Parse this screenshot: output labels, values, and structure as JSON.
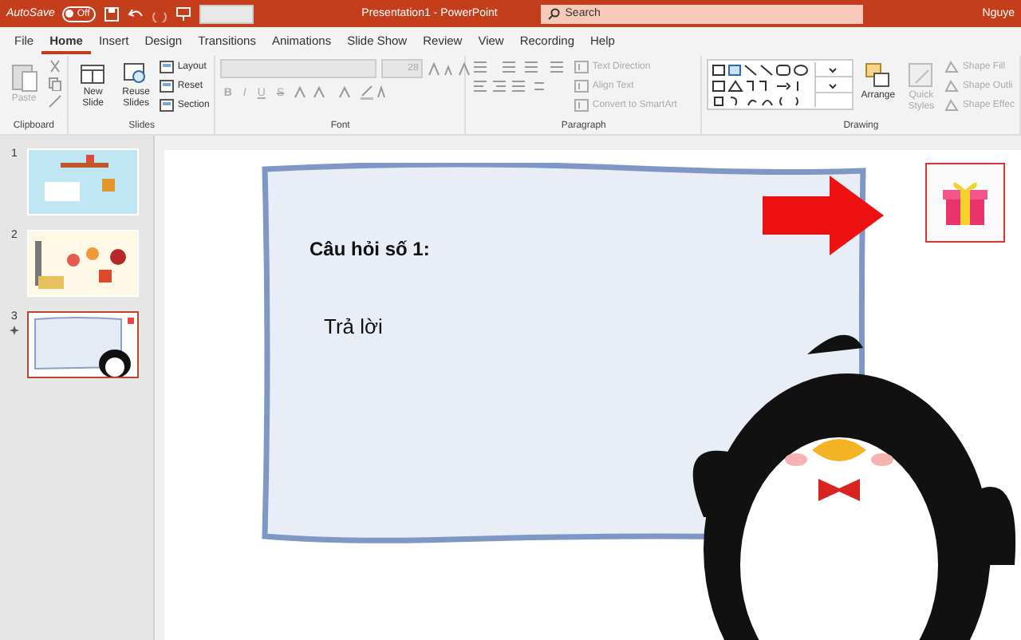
{
  "title_bar": {
    "autosave_label": "AutoSave",
    "autosave_on": false,
    "autosave_state": "Off",
    "title": "Presentation1 - PowerPoint",
    "search_placeholder": "Search",
    "user": "Nguye"
  },
  "tabs": [
    {
      "label": "File",
      "selected": false
    },
    {
      "label": "Home",
      "selected": true
    },
    {
      "label": "Insert",
      "selected": false
    },
    {
      "label": "Design",
      "selected": false
    },
    {
      "label": "Transitions",
      "selected": false
    },
    {
      "label": "Animations",
      "selected": false
    },
    {
      "label": "Slide Show",
      "selected": false
    },
    {
      "label": "Review",
      "selected": false
    },
    {
      "label": "View",
      "selected": false
    },
    {
      "label": "Recording",
      "selected": false
    },
    {
      "label": "Help",
      "selected": false
    }
  ],
  "ribbon": [
    {
      "name": "Clipboard",
      "kind": "clipboard",
      "items": [
        {
          "label": "Paste",
          "disabled": true
        }
      ]
    },
    {
      "name": "Slides",
      "kind": "slides",
      "items": [
        {
          "label": "New Slide",
          "disabled": false
        },
        {
          "label": "Reuse Slides",
          "disabled": false
        },
        {
          "label": "Layout",
          "disabled": false
        },
        {
          "label": "Reset",
          "disabled": false
        },
        {
          "label": "Section",
          "disabled": false
        }
      ]
    },
    {
      "name": "Font",
      "kind": "font",
      "font_size": "28",
      "items": [
        {
          "label": "B",
          "disabled": true
        },
        {
          "label": "I",
          "disabled": true
        },
        {
          "label": "U",
          "disabled": true
        },
        {
          "label": "S",
          "disabled": true
        }
      ]
    },
    {
      "name": "Paragraph",
      "kind": "paragraph",
      "items": [
        {
          "label": "Text Direction",
          "disabled": true
        },
        {
          "label": "Align Text",
          "disabled": true
        },
        {
          "label": "Convert to SmartArt",
          "disabled": true
        }
      ]
    },
    {
      "name": "Drawing",
      "kind": "drawing",
      "items": [
        {
          "label": "Arrange",
          "disabled": false
        },
        {
          "label": "Quick Styles",
          "disabled": true
        },
        {
          "label": "Shape Fill",
          "disabled": true
        },
        {
          "label": "Shape Outli",
          "disabled": true
        },
        {
          "label": "Shape Effec",
          "disabled": true
        }
      ]
    }
  ],
  "slides": [
    {
      "number": "1",
      "selected": false,
      "has_animation": false
    },
    {
      "number": "2",
      "selected": false,
      "has_animation": false
    },
    {
      "number": "3",
      "selected": true,
      "has_animation": true
    }
  ],
  "slide": {
    "question": "Câu hỏi số 1:",
    "answer": "Trả lời"
  }
}
